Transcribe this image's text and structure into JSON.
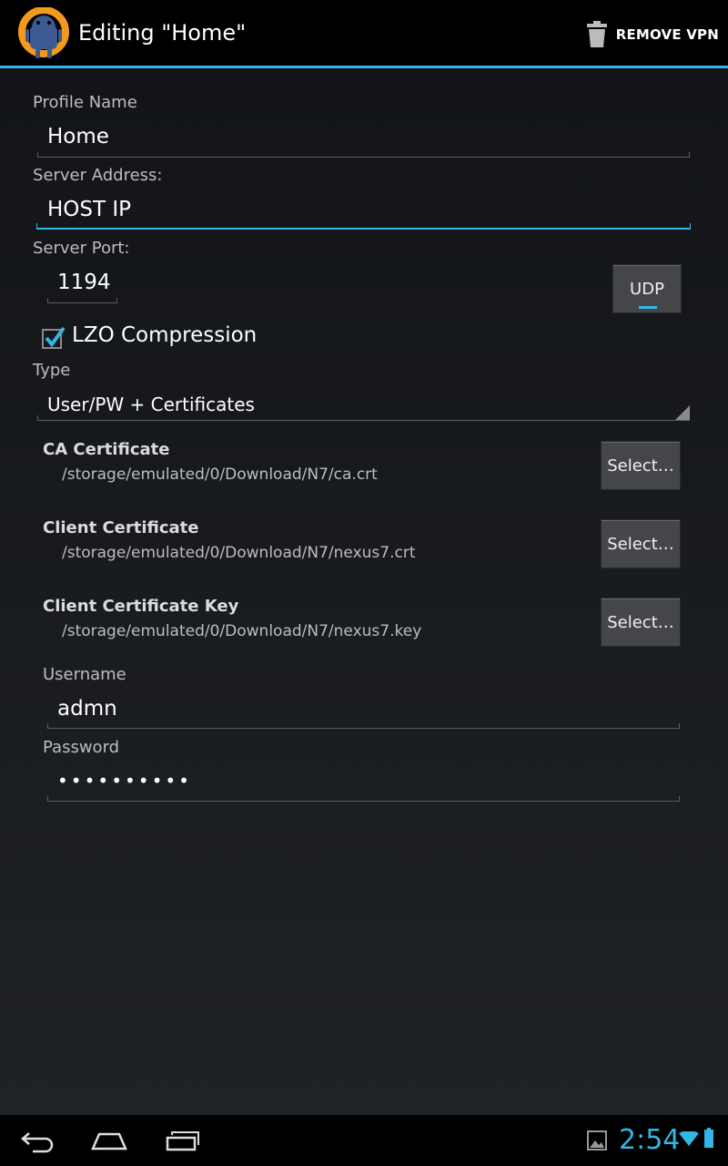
{
  "action_bar": {
    "title": "Editing \"Home\"",
    "remove_label": "REMOVE VPN"
  },
  "form": {
    "profile_name": {
      "label": "Profile Name",
      "value": "Home"
    },
    "server_address": {
      "label": "Server Address:",
      "value": "HOST IP"
    },
    "server_port": {
      "label": "Server Port:",
      "value": "1194"
    },
    "protocol_button": "UDP",
    "lzo": {
      "label": "LZO Compression",
      "checked": true
    },
    "type": {
      "label": "Type",
      "value": "User/PW + Certificates"
    },
    "certificates": [
      {
        "title": "CA Certificate",
        "path": "/storage/emulated/0/Download/N7/ca.crt",
        "button": "Select…"
      },
      {
        "title": "Client Certificate",
        "path": "/storage/emulated/0/Download/N7/nexus7.crt",
        "button": "Select…"
      },
      {
        "title": "Client Certificate Key",
        "path": "/storage/emulated/0/Download/N7/nexus7.key",
        "button": "Select…"
      }
    ],
    "username": {
      "label": "Username",
      "value": "admn"
    },
    "password": {
      "label": "Password",
      "value": "••••••••••"
    }
  },
  "nav_bar": {
    "time": "2:54",
    "icons": [
      "back-icon",
      "home-icon",
      "recent-apps-icon",
      "gallery-notification-icon",
      "wifi-icon",
      "battery-icon"
    ]
  },
  "colors": {
    "accent": "#33b5e5",
    "app_orange": "#f39a1e"
  }
}
